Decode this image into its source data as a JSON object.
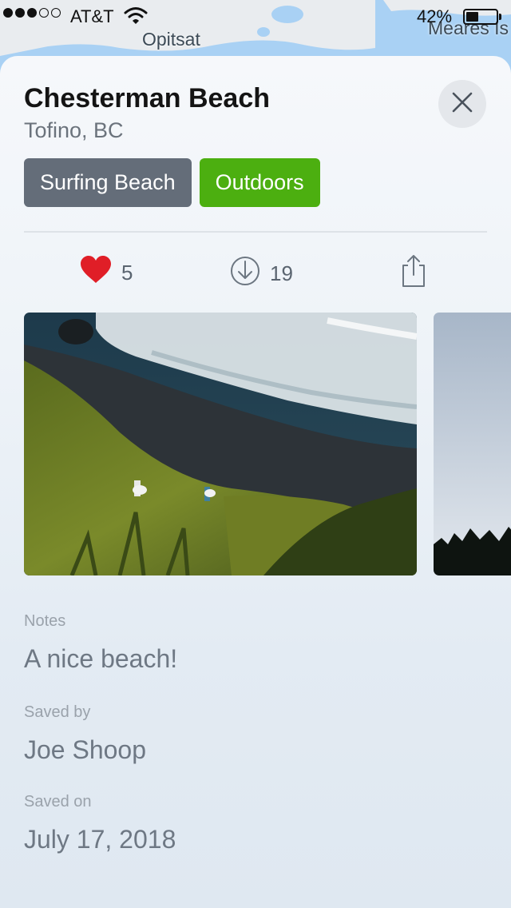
{
  "status_bar": {
    "signal_dots": 5,
    "signal_filled": 3,
    "carrier": "AT&T",
    "battery_percent": "42%",
    "battery_level": 0.42
  },
  "map": {
    "labels": {
      "town": "Opitsat",
      "island": "Meares Is"
    },
    "colors": {
      "water": "#a9d1f4",
      "land": "#e9ecef"
    }
  },
  "place": {
    "title": "Chesterman Beach",
    "location": "Tofino, BC",
    "tags": [
      {
        "label": "Surfing Beach",
        "color": "#646d79"
      },
      {
        "label": "Outdoors",
        "color": "#4caf10"
      }
    ]
  },
  "actions": {
    "likes": {
      "icon": "heart-icon",
      "count": "5",
      "color": "#e01e27"
    },
    "downloads": {
      "icon": "download-circle-icon",
      "count": "19"
    },
    "share": {
      "icon": "share-icon"
    }
  },
  "photos": [
    {
      "icon": "photo-rocky-coast-surfers"
    },
    {
      "icon": "photo-sky-treeline"
    }
  ],
  "info": {
    "notes_label": "Notes",
    "notes_value": "A nice beach!",
    "saved_by_label": "Saved by",
    "saved_by_value": "Joe Shoop",
    "saved_on_label": "Saved on",
    "saved_on_value": "July 17, 2018"
  },
  "close": {
    "icon": "close-icon"
  }
}
